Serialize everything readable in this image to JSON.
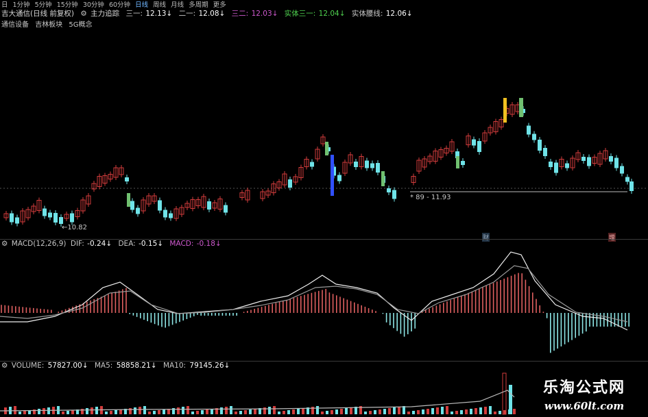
{
  "toolbar": {
    "tabs": [
      "1分钟",
      "5分钟",
      "15分钟",
      "30分钟",
      "60分钟",
      "日线",
      "周线",
      "月线",
      "多周期",
      "更多"
    ],
    "prefix": "日",
    "active_tab": "日线"
  },
  "header": {
    "title": "吉大通信(日线 前复权)",
    "indicator": "主力追踪",
    "line1_label": "三一:",
    "line1_value": "12.13↓",
    "line2_label": "二一:",
    "line2_value": "12.08↓",
    "line3_label": "三二:",
    "line3_value": "12.03↓",
    "line4_label": "实体三一:",
    "line4_value": "12.04↓",
    "line5_label": "实体腰线:",
    "line5_value": "12.06↓"
  },
  "sectors": {
    "s1": "通信设备",
    "s2": "吉林板块",
    "s3": "5G概念"
  },
  "price_panel": {
    "low_label": "←10.82",
    "range_label": "* 89 - 11.93",
    "marker1": "财",
    "marker2": "增"
  },
  "macd": {
    "title": "MACD(12,26,9)",
    "dif_label": "DIF:",
    "dif_value": "-0.24↓",
    "dea_label": "DEA:",
    "dea_value": "-0.15↓",
    "macd_label": "MACD:",
    "macd_value": "-0.18↓"
  },
  "volume": {
    "title": "VOLUME:",
    "value": "57827.00↓",
    "ma5_label": "MA5:",
    "ma5_value": "58858.21↓",
    "ma10_label": "MA10:",
    "ma10_value": "79145.26↓"
  },
  "watermark": {
    "cn": "乐淘公式网",
    "url": "www.60lt.com"
  },
  "colors": {
    "up": "#d23c3c",
    "down": "#6fe3e8",
    "bg": "#000000",
    "line1": "#c8c8c8",
    "line3": "#d05ad0",
    "line4": "#4fd24f",
    "yellow": "#f0c020",
    "blue": "#3050ff",
    "green": "#70c070"
  }
}
